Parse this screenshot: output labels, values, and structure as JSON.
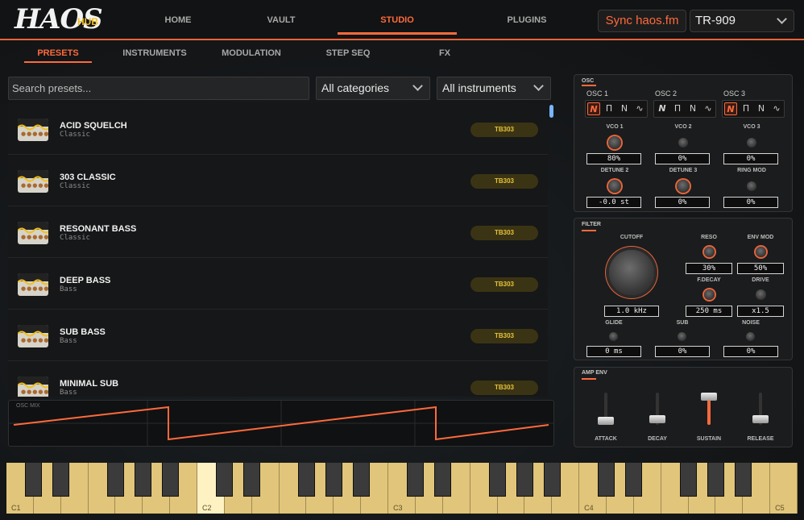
{
  "brand": {
    "logo": "HAOS",
    "hub": "HUB"
  },
  "nav": [
    {
      "label": "HOME",
      "active": false
    },
    {
      "label": "VAULT",
      "active": false
    },
    {
      "label": "STUDIO",
      "active": true
    },
    {
      "label": "PLUGINS",
      "active": false
    }
  ],
  "header": {
    "sync_label": "Sync haos.fm",
    "device": "TR-909"
  },
  "subtabs": [
    {
      "label": "PRESETS",
      "active": true
    },
    {
      "label": "INSTRUMENTS",
      "active": false
    },
    {
      "label": "MODULATION",
      "active": false
    },
    {
      "label": "STEP SEQ",
      "active": false
    },
    {
      "label": "FX",
      "active": false
    }
  ],
  "filters": {
    "search_placeholder": "Search presets...",
    "category": "All categories",
    "instrument": "All instruments"
  },
  "presets": [
    {
      "name": "ACID SQUELCH",
      "category": "Classic",
      "tag": "TB303"
    },
    {
      "name": "303 CLASSIC",
      "category": "Classic",
      "tag": "TB303"
    },
    {
      "name": "RESONANT BASS",
      "category": "Classic",
      "tag": "TB303"
    },
    {
      "name": "DEEP BASS",
      "category": "Bass",
      "tag": "TB303"
    },
    {
      "name": "SUB BASS",
      "category": "Bass",
      "tag": "TB303"
    },
    {
      "name": "MINIMAL SUB",
      "category": "Bass",
      "tag": "TB303"
    }
  ],
  "osc_mix": {
    "label": "OSC MIX"
  },
  "osc": {
    "title": "OSC",
    "oscillators": [
      {
        "label": "OSC 1",
        "active_wave": 0
      },
      {
        "label": "OSC 2",
        "active_wave": -1
      },
      {
        "label": "OSC 3",
        "active_wave": 0
      }
    ],
    "waves": [
      "saw-wave-icon",
      "square-wave-icon",
      "ramp-wave-icon",
      "sine-wave-icon"
    ],
    "params_row1": [
      {
        "label": "VCO 1",
        "value": "80%"
      },
      {
        "label": "VCO 2",
        "value": "0%"
      },
      {
        "label": "VCO 3",
        "value": "0%"
      }
    ],
    "params_row2": [
      {
        "label": "DETUNE 2",
        "value": "-0.0 st"
      },
      {
        "label": "DETUNE 3",
        "value": "0%"
      },
      {
        "label": "RING MOD",
        "value": "0%"
      }
    ]
  },
  "filter": {
    "title": "FILTER",
    "cutoff": {
      "label": "CUTOFF",
      "value": "1.0 kHz"
    },
    "reso": {
      "label": "RESO",
      "value": "30%"
    },
    "env_mod": {
      "label": "ENV MOD",
      "value": "50%"
    },
    "f_decay": {
      "label": "F.DECAY",
      "value": "250 ms"
    },
    "drive": {
      "label": "DRIVE",
      "value": "x1.5"
    },
    "glide": {
      "label": "GLIDE",
      "value": "0 ms"
    },
    "sub": {
      "label": "SUB",
      "value": "0%"
    },
    "noise": {
      "label": "NOISE",
      "value": "0%"
    }
  },
  "amp_env": {
    "title": "AMP ENV",
    "faders": [
      {
        "label": "ATTACK",
        "level": 0.0
      },
      {
        "label": "DECAY",
        "level": 0.08
      },
      {
        "label": "SUSTAIN",
        "level": 1.0
      },
      {
        "label": "RELEASE",
        "level": 0.08
      }
    ]
  },
  "keyboard": {
    "octave_labels": [
      "C1",
      "C2",
      "C3",
      "C4",
      "C5"
    ],
    "active_key": "C2"
  },
  "colors": {
    "accent": "#ff6a3c",
    "badge": "#e6c23a",
    "key": "#e1c57a"
  }
}
